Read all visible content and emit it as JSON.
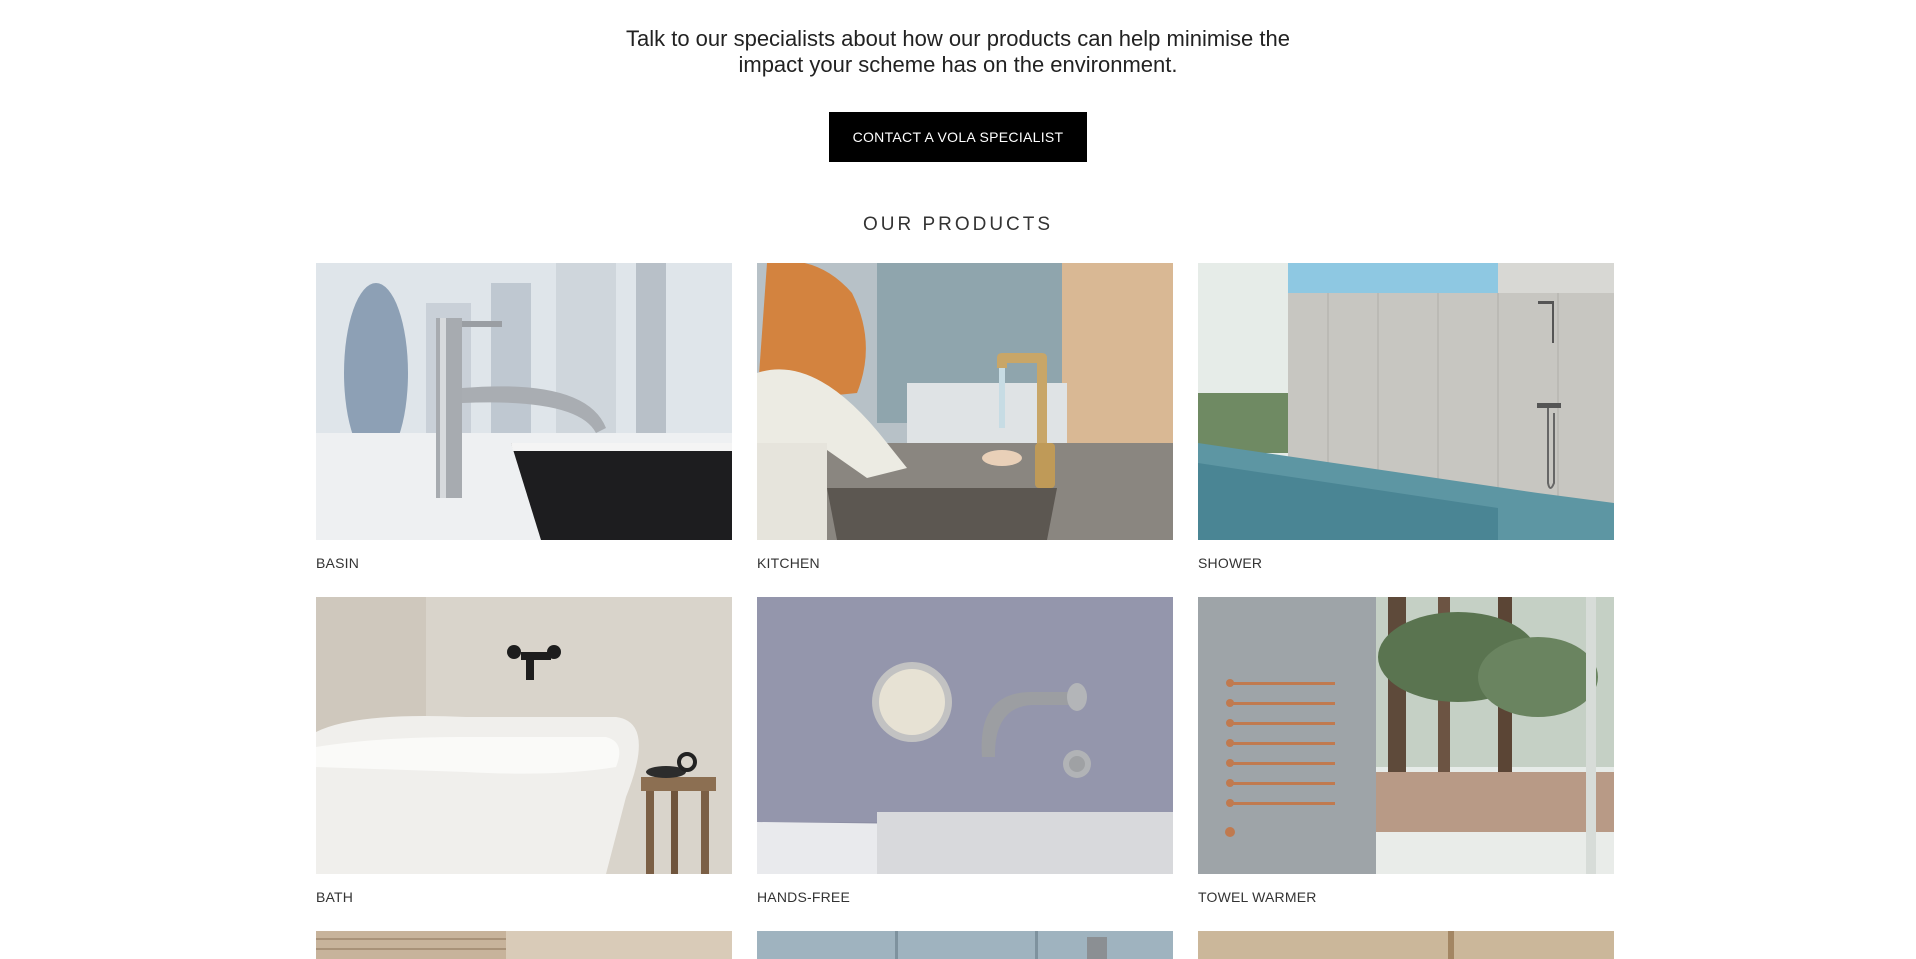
{
  "intro": {
    "line1": "Talk to our specialists about how our products can help minimise the",
    "line2": "impact your scheme has on the environment."
  },
  "cta": {
    "label": "CONTACT A VOLA SPECIALIST"
  },
  "products": {
    "title": "OUR PRODUCTS",
    "items": [
      {
        "label": "BASIN"
      },
      {
        "label": "KITCHEN"
      },
      {
        "label": "SHOWER"
      },
      {
        "label": "BATH"
      },
      {
        "label": "HANDS-FREE"
      },
      {
        "label": "TOWEL WARMER"
      }
    ]
  },
  "colors": {
    "button_bg": "#000000",
    "button_text": "#ffffff",
    "text": "#222222"
  }
}
